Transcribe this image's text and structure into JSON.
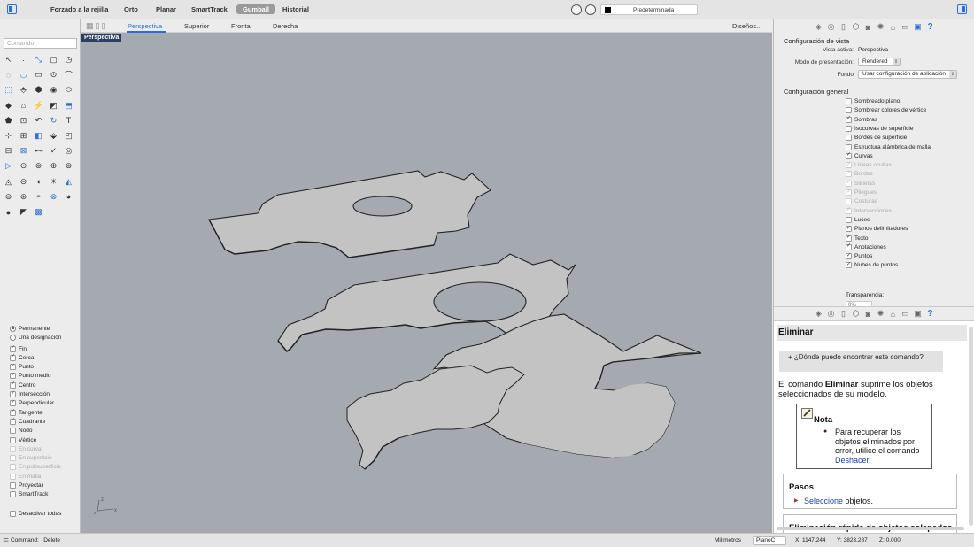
{
  "topbar": {
    "buttons": [
      "Forzado a la rejilla",
      "Orto",
      "Planar",
      "SmartTrack",
      "Gumball",
      "Historial"
    ],
    "active_button": "Gumball",
    "layer": "Predeterminada"
  },
  "command": {
    "placeholder": "Comando"
  },
  "osnap": {
    "mode_permanent": "Permanente",
    "mode_once": "Una designación",
    "items": [
      {
        "label": "Fin",
        "checked": true,
        "enabled": true
      },
      {
        "label": "Cerca",
        "checked": true,
        "enabled": true
      },
      {
        "label": "Punto",
        "checked": true,
        "enabled": true
      },
      {
        "label": "Punto medio",
        "checked": true,
        "enabled": true
      },
      {
        "label": "Centro",
        "checked": true,
        "enabled": true
      },
      {
        "label": "Intersección",
        "checked": true,
        "enabled": true
      },
      {
        "label": "Perpendicular",
        "checked": true,
        "enabled": true
      },
      {
        "label": "Tangente",
        "checked": true,
        "enabled": true
      },
      {
        "label": "Cuadrante",
        "checked": true,
        "enabled": true
      },
      {
        "label": "Nodo",
        "checked": false,
        "enabled": true
      },
      {
        "label": "Vértice",
        "checked": false,
        "enabled": true
      },
      {
        "label": "En curva",
        "checked": false,
        "enabled": false
      },
      {
        "label": "En superficie",
        "checked": false,
        "enabled": false
      },
      {
        "label": "En polisuperficie",
        "checked": false,
        "enabled": false
      },
      {
        "label": "En malla",
        "checked": false,
        "enabled": false
      },
      {
        "label": "Proyectar",
        "checked": false,
        "enabled": true
      },
      {
        "label": "SmartTrack",
        "checked": false,
        "enabled": true
      }
    ],
    "disable_all": "Desactivar todas"
  },
  "viewtabs": {
    "tabs": [
      "Perspectiva",
      "Superior",
      "Frontal",
      "Derecha"
    ],
    "active": "Perspectiva",
    "layouts": "Diseños..."
  },
  "viewport": {
    "label": "Perspectiva",
    "axes": {
      "z": "z",
      "x": "x"
    }
  },
  "properties": {
    "view_title": "Configuración de vista",
    "active_view_label": "Vista activa:",
    "active_view_value": "Perspectiva",
    "display_mode_label": "Modo de presentación:",
    "display_mode_value": "Rendered",
    "background_label": "Fondo",
    "background_value": "Usar configuración de aplicación",
    "general_title": "Configuración general",
    "options": [
      {
        "label": "Sombreado plano",
        "checked": false,
        "enabled": true
      },
      {
        "label": "Sombrear colores de vértice",
        "checked": false,
        "enabled": true
      },
      {
        "label": "Sombras",
        "checked": true,
        "enabled": true
      },
      {
        "label": "Isocurvas de superficie",
        "checked": false,
        "enabled": true
      },
      {
        "label": "Bordes de superficie",
        "checked": false,
        "enabled": true
      },
      {
        "label": "Estructura alámbrica de malla",
        "checked": false,
        "enabled": true
      },
      {
        "label": "Curvas",
        "checked": true,
        "enabled": true
      },
      {
        "label": "Líneas ocultas",
        "checked": true,
        "enabled": false
      },
      {
        "label": "Bordes",
        "checked": true,
        "enabled": false
      },
      {
        "label": "Siluetas",
        "checked": true,
        "enabled": false
      },
      {
        "label": "Pliegues",
        "checked": true,
        "enabled": false
      },
      {
        "label": "Costuras",
        "checked": false,
        "enabled": false
      },
      {
        "label": "Intersecciones",
        "checked": true,
        "enabled": false
      },
      {
        "label": "Luces",
        "checked": false,
        "enabled": true
      },
      {
        "label": "Planos delimitadores",
        "checked": true,
        "enabled": true
      },
      {
        "label": "Texto",
        "checked": true,
        "enabled": true
      },
      {
        "label": "Anotaciones",
        "checked": true,
        "enabled": true
      },
      {
        "label": "Puntos",
        "checked": true,
        "enabled": true
      },
      {
        "label": "Nubes de puntos",
        "checked": true,
        "enabled": true
      }
    ],
    "transparency_label": "Transparencia:",
    "transparency_value": "0%"
  },
  "help": {
    "title": "Eliminar",
    "where": "+ ¿Dónde puedo encontrar este comando?",
    "desc_pre": "El comando ",
    "desc_bold": "Eliminar",
    "desc_post": " suprime los objetos seleccionados de su modelo.",
    "note_title": "Nota",
    "note_pre": "Para recuperar los objetos eliminados por error, utilice el comando ",
    "note_link": "Deshacer",
    "note_post": ".",
    "steps_title": "Pasos",
    "steps_link": "Seleccione",
    "steps_post": " objetos.",
    "overlap_title": "Eliminación rápida de objetos solapados"
  },
  "statusbar": {
    "command": "Command: _Delete",
    "units": "Milímetros",
    "cplane": "PlanoC",
    "x": "X: 1147.244",
    "y": "Y: 3823.287",
    "z": "Z: 0.000"
  },
  "colors": {
    "accent": "#2a6fd6",
    "viewport_bg": "#a5a9b0",
    "shape_fill": "#c3c3c3",
    "viewport_label_bg": "#2c3e66"
  }
}
